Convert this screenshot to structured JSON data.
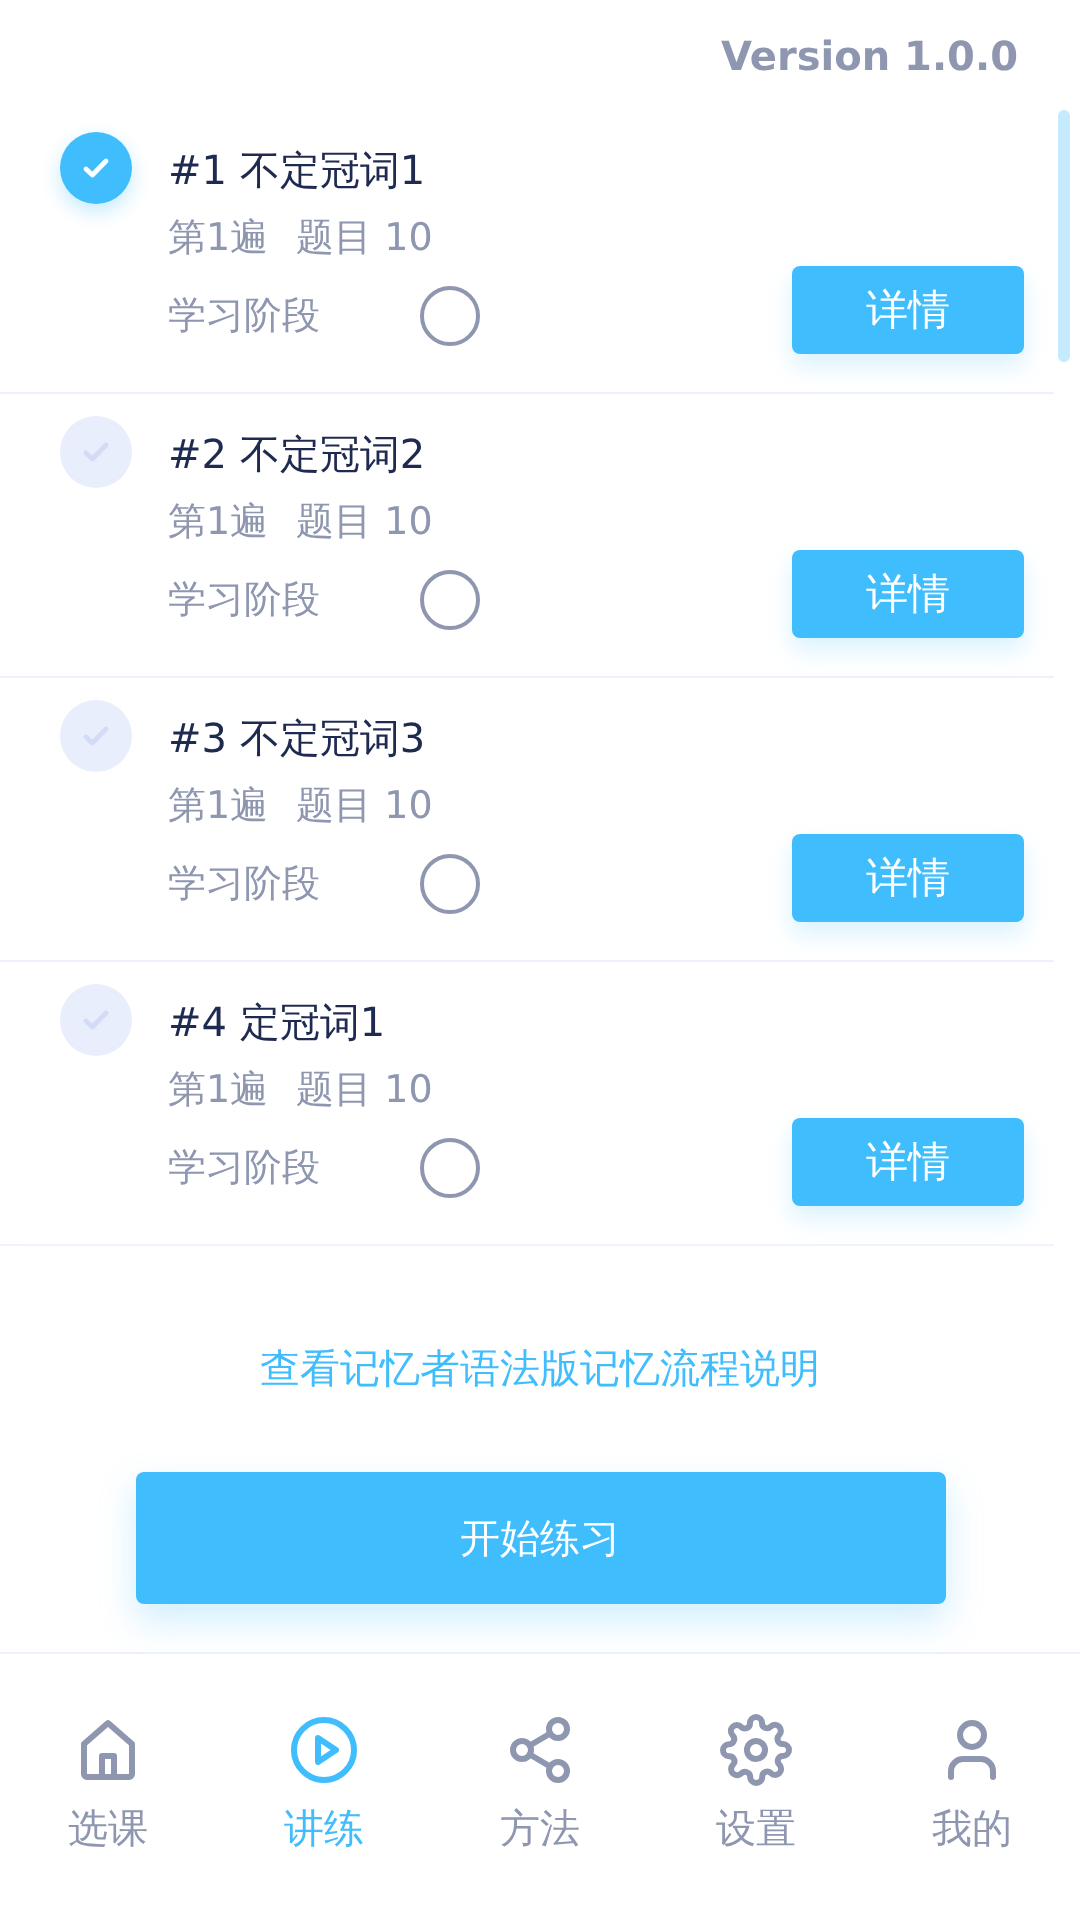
{
  "version": "Version 1.0.0",
  "lessons": [
    {
      "title": "#1 不定冠词1",
      "round": "第1遍",
      "questions_label": "题目",
      "questions": "10",
      "stage_label": "学习阶段",
      "button": "详情",
      "checked": true
    },
    {
      "title": "#2 不定冠词2",
      "round": "第1遍",
      "questions_label": "题目",
      "questions": "10",
      "stage_label": "学习阶段",
      "button": "详情",
      "checked": false
    },
    {
      "title": "#3 不定冠词3",
      "round": "第1遍",
      "questions_label": "题目",
      "questions": "10",
      "stage_label": "学习阶段",
      "button": "详情",
      "checked": false
    },
    {
      "title": "#4 定冠词1",
      "round": "第1遍",
      "questions_label": "题目",
      "questions": "10",
      "stage_label": "学习阶段",
      "button": "详情",
      "checked": false
    }
  ],
  "guide_link": "查看记忆者语法版记忆流程说明",
  "start_button": "开始练习",
  "nav": [
    {
      "label": "选课",
      "kind": "home",
      "selected": false
    },
    {
      "label": "讲练",
      "kind": "play",
      "selected": true
    },
    {
      "label": "方法",
      "kind": "share",
      "selected": false
    },
    {
      "label": "设置",
      "kind": "gear",
      "selected": false
    },
    {
      "label": "我的",
      "kind": "user",
      "selected": false
    }
  ]
}
